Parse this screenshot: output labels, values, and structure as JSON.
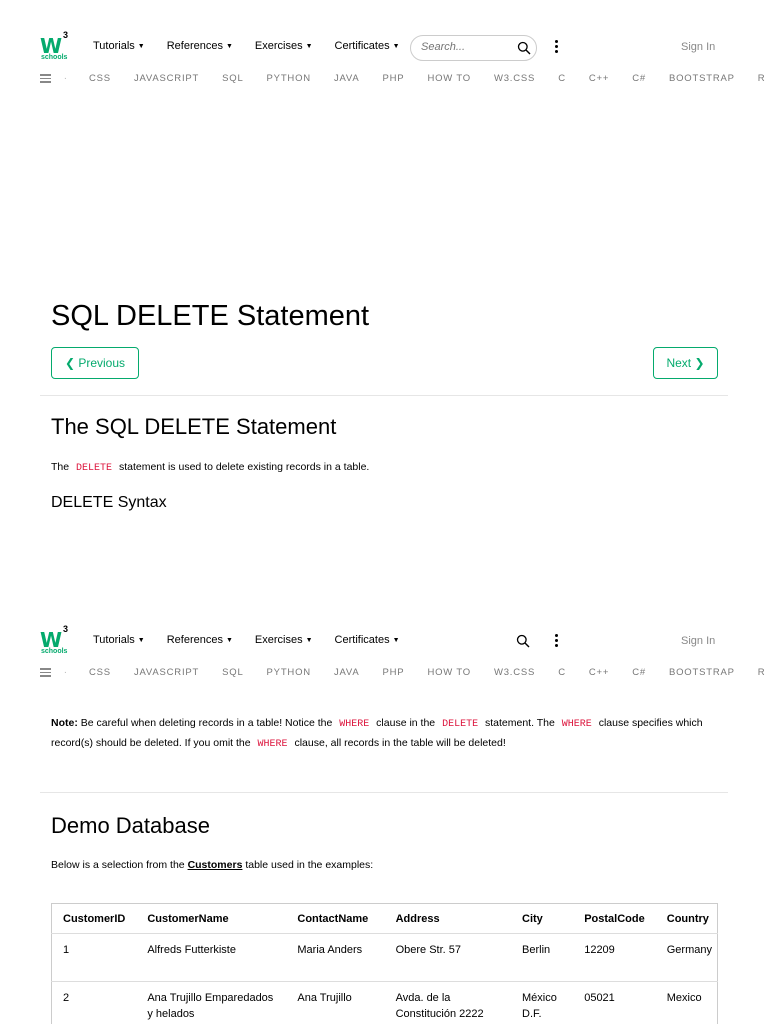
{
  "header": {
    "logo_text": "W",
    "logo_sup": "3",
    "logo_sub": "schools",
    "menu": [
      {
        "label": "Tutorials"
      },
      {
        "label": "References"
      },
      {
        "label": "Exercises"
      },
      {
        "label": "Certificates"
      }
    ],
    "search_placeholder": "Search...",
    "sign_in": "Sign In",
    "subnav_dot": ".",
    "subnav": [
      "CSS",
      "JAVASCRIPT",
      "SQL",
      "PYTHON",
      "JAVA",
      "PHP",
      "HOW TO",
      "W3.CSS",
      "C",
      "C++",
      "C#",
      "BOOTSTRAP",
      "R"
    ]
  },
  "page": {
    "title": "SQL DELETE Statement",
    "prev_label": "❮ Previous",
    "next_label": "Next ❯",
    "section_title": "The SQL DELETE Statement",
    "intro_before": "The",
    "intro_code": "DELETE",
    "intro_after": "statement is used to delete existing records in a table.",
    "syntax_title": "DELETE Syntax"
  },
  "note": {
    "bold": "Note:",
    "t1": " Be careful when deleting records in a table! Notice the ",
    "c1": "WHERE",
    "t2": " clause in the ",
    "c2": "DELETE",
    "t3": " statement. The ",
    "c3": "WHERE",
    "t4": " clause specifies which record(s) should be deleted. If you omit the ",
    "c4": "WHERE",
    "t5": " clause, all records in the table will be deleted!"
  },
  "demo": {
    "title": "Demo Database",
    "intro_before": "Below is a selection from the ",
    "intro_link": "Customers",
    "intro_after": " table used in the examples:",
    "columns": [
      "CustomerID",
      "CustomerName",
      "ContactName",
      "Address",
      "City",
      "PostalCode",
      "Country"
    ],
    "rows": [
      [
        "1",
        "Alfreds Futterkiste",
        "Maria Anders",
        "Obere Str. 57",
        "Berlin",
        "12209",
        "Germany"
      ],
      [
        "2",
        "Ana Trujillo Emparedados y helados",
        "Ana Trujillo",
        "Avda. de la Constitución 2222",
        "México D.F.",
        "05021",
        "Mexico"
      ]
    ]
  },
  "colors": {
    "accent": "#04AA6D",
    "code": "#DC143C"
  }
}
